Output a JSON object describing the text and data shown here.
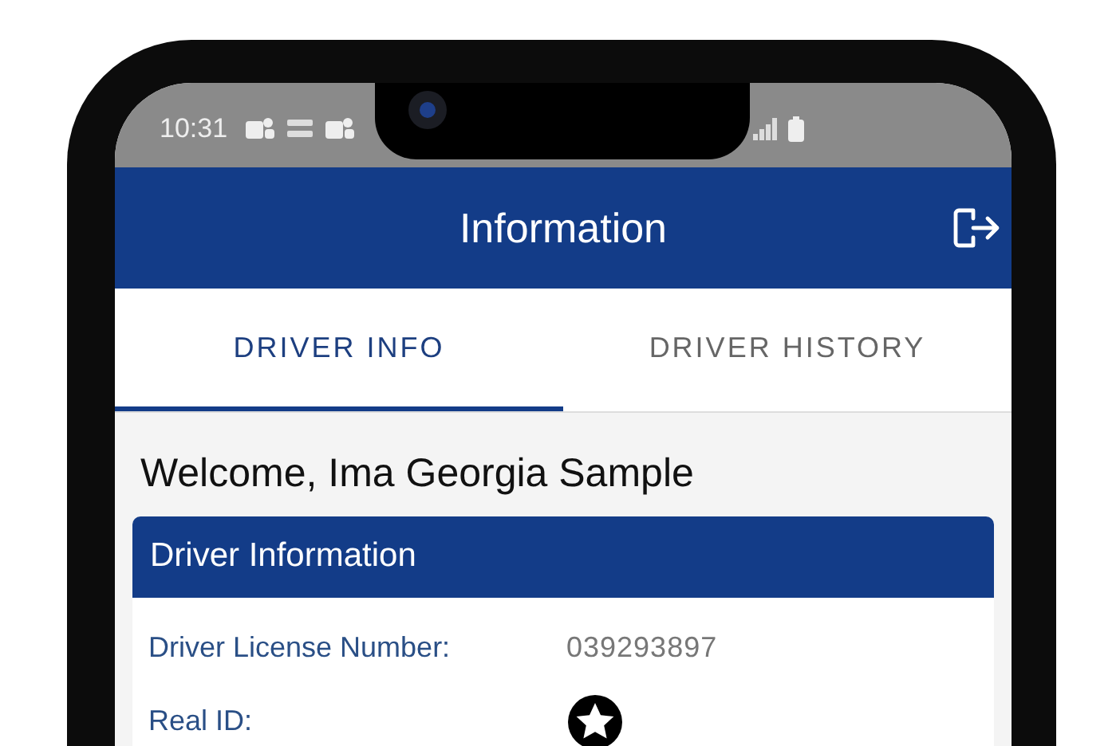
{
  "status_bar": {
    "time": "10:31"
  },
  "app_bar": {
    "title": "Information"
  },
  "tabs": [
    {
      "label": "DRIVER INFO",
      "selected": true
    },
    {
      "label": "DRIVER HISTORY",
      "selected": false
    }
  ],
  "welcome": "Welcome, Ima Georgia Sample",
  "card": {
    "title": "Driver Information",
    "fields": [
      {
        "kind": "text",
        "label": "Driver License Number:",
        "value": "039293897"
      },
      {
        "kind": "star",
        "label": "Real ID:"
      }
    ]
  }
}
